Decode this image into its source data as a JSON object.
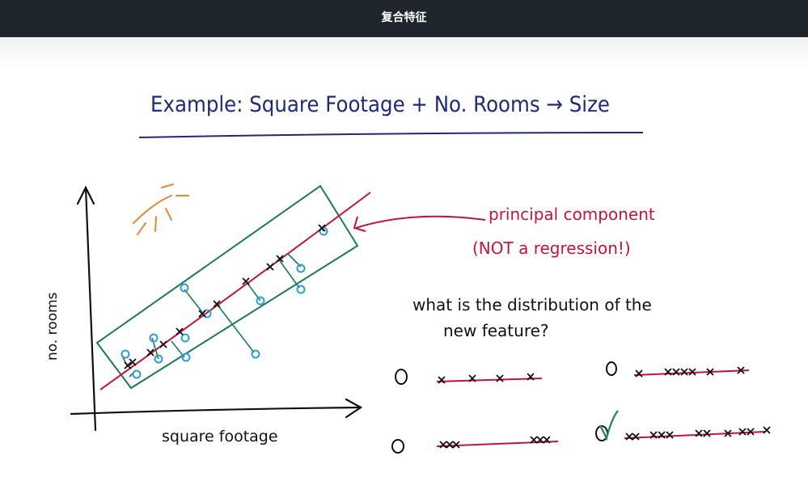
{
  "window": {
    "title": "复合特征"
  },
  "slide": {
    "heading": "Example:  Square Footage + No. Rooms → Size",
    "annotation_line1": "principal component",
    "annotation_line2": "(NOT a regression!)",
    "question_line1": "what is the distribution of the",
    "question_line2": "new feature?",
    "x_axis_label": "square footage",
    "y_axis_label": "no. rooms",
    "options": [
      {
        "id": "a",
        "marker": "o",
        "selected": false
      },
      {
        "id": "b",
        "marker": "o",
        "selected": false
      },
      {
        "id": "c",
        "marker": "o",
        "selected": false
      },
      {
        "id": "d",
        "marker": "o",
        "selected": true
      }
    ]
  },
  "colors": {
    "title_ink": "#1f2a78",
    "red_ink": "#c4143c",
    "green_ink": "#1a7a5a",
    "blue_ink": "#2a9fd0",
    "sun": "#e8872c",
    "check": "#2f8a5a"
  }
}
